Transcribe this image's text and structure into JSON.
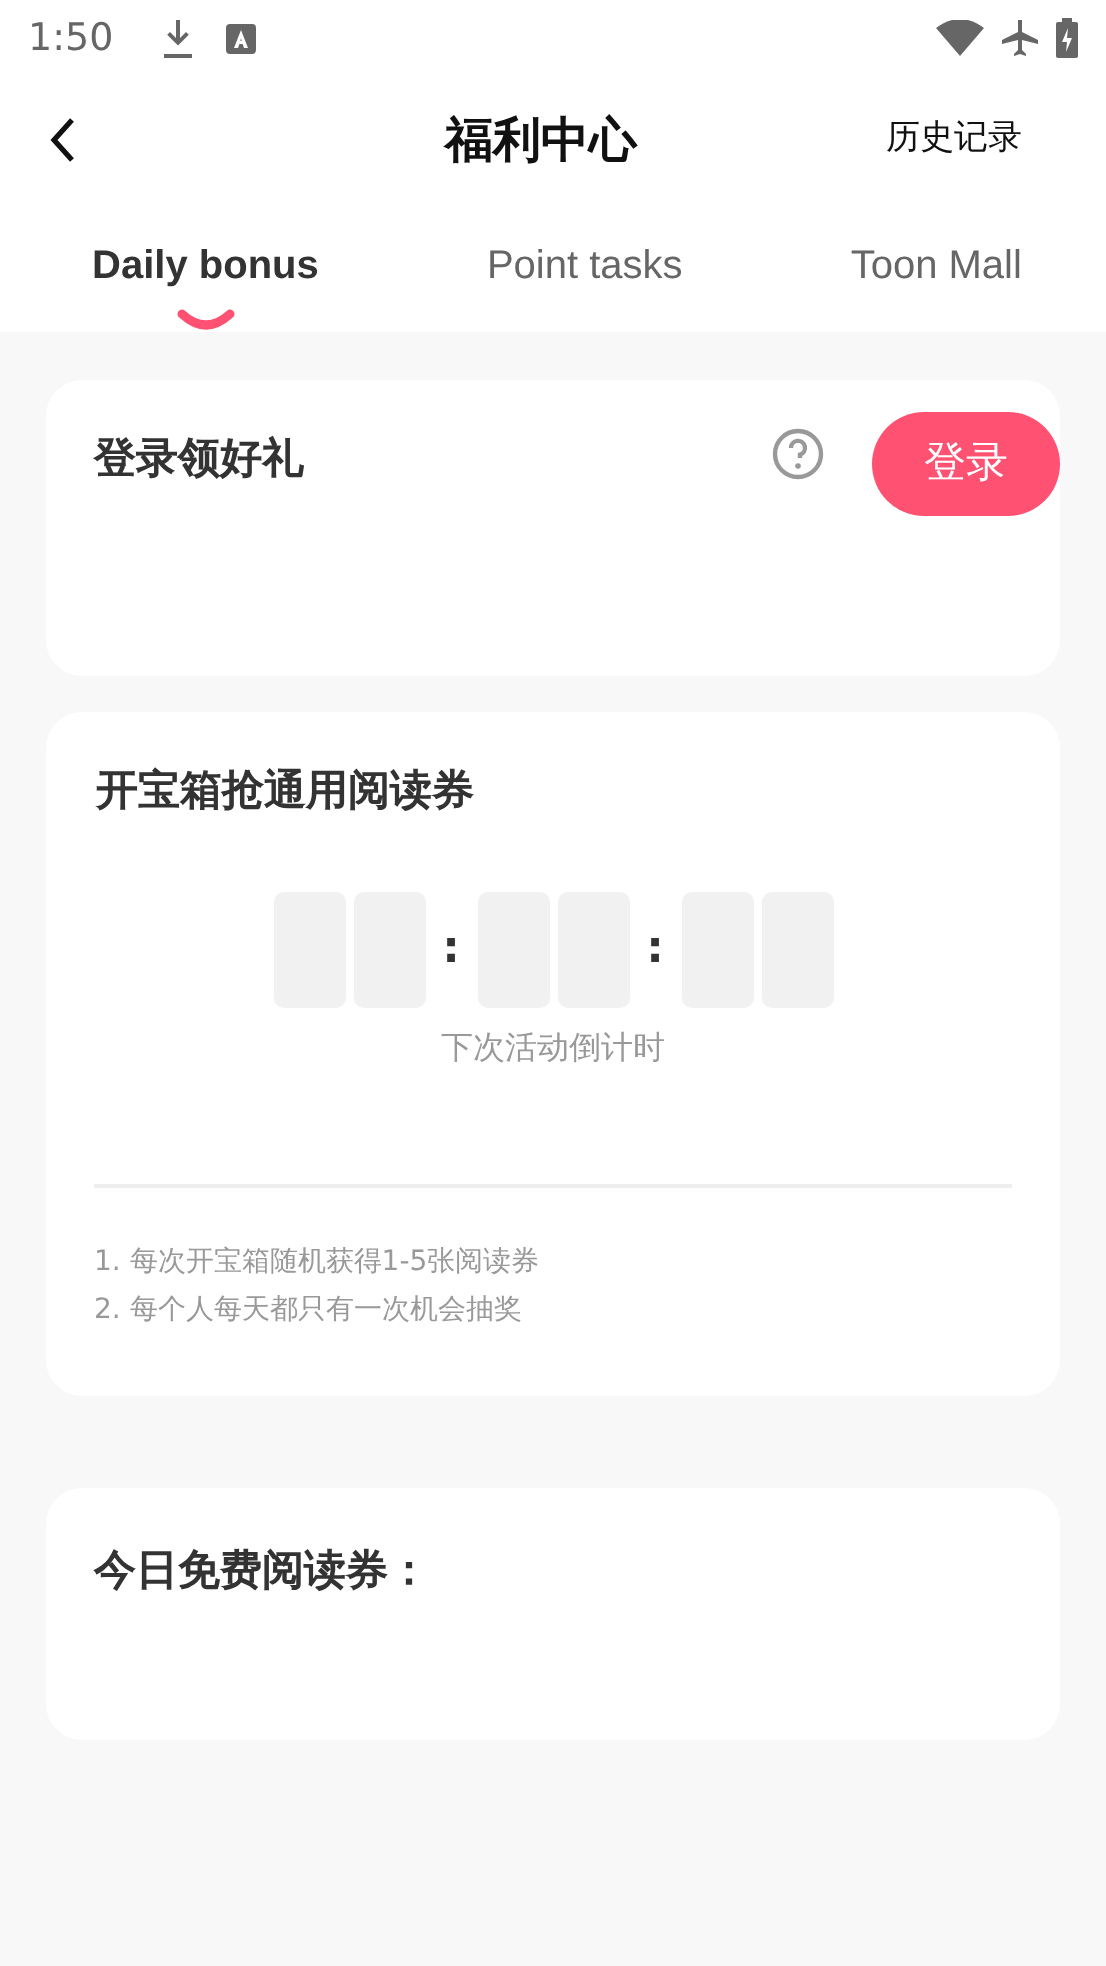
{
  "status_bar": {
    "time": "1:50"
  },
  "header": {
    "title": "福利中心",
    "action": "历史记录"
  },
  "tabs": [
    {
      "label": "Daily bonus",
      "selected": true
    },
    {
      "label": "Point tasks",
      "selected": false
    },
    {
      "label": "Toon Mall",
      "selected": false
    }
  ],
  "login_card": {
    "title": "登录领好礼",
    "button": "登录"
  },
  "chest_card": {
    "title": "开宝箱抢通用阅读券",
    "timer_separators": [
      ":",
      ":"
    ],
    "caption": "下次活动倒计时",
    "rules": [
      "1. 每次开宝箱随机获得1-5张阅读券",
      "2. 每个人每天都只有一次机会抽奖"
    ]
  },
  "free_card": {
    "title": "今日免费阅读券："
  }
}
